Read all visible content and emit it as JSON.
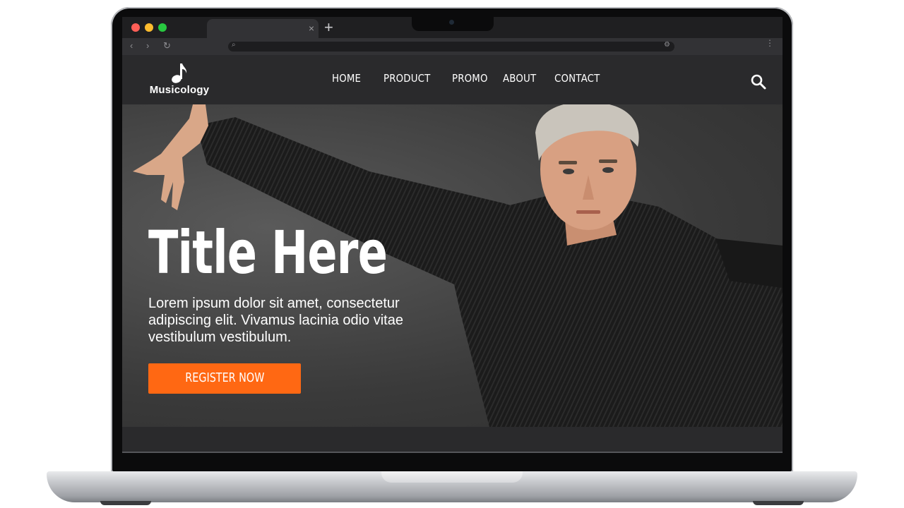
{
  "browser": {
    "tab_close_glyph": "×",
    "new_tab_glyph": "+",
    "traffic_colors": [
      "#ff5f57",
      "#febc2e",
      "#28c840"
    ]
  },
  "site": {
    "logo_text": "Musicology",
    "nav": [
      "HOME",
      "PRODUCT",
      "PROMO",
      "ABOUT",
      "CONTACT"
    ],
    "search_icon": "search-icon"
  },
  "hero": {
    "title": "Title Here",
    "body": "Lorem ipsum dolor sit amet, consectetur adipiscing elit. Vivamus lacinia odio vitae vestibulum vestibulum.",
    "cta_label": "REGISTER NOW",
    "cta_color": "#ff6813"
  }
}
